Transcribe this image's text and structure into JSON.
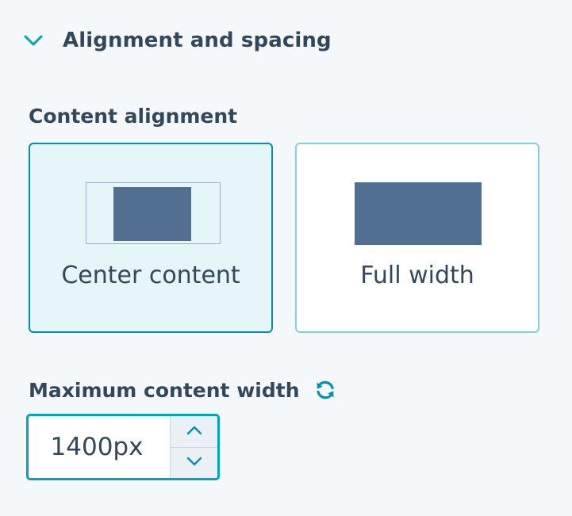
{
  "section": {
    "title": "Alignment and spacing",
    "chevron_icon": "chevron-down-icon",
    "expanded": true
  },
  "content_alignment": {
    "label": "Content alignment",
    "selected": "center",
    "options": [
      {
        "id": "center",
        "label": "Center content"
      },
      {
        "id": "full",
        "label": "Full width"
      }
    ]
  },
  "max_width": {
    "label": "Maximum content width",
    "reset_icon": "reset-refresh-icon",
    "value": "1400px",
    "increment_icon": "chevron-up-icon",
    "decrement_icon": "chevron-down-icon"
  },
  "colors": {
    "background": "#f5f8fa",
    "text": "#33475b",
    "accent": "#00a4bd",
    "selected_bg": "#e5f5f8",
    "preview_fill": "#516f90"
  }
}
